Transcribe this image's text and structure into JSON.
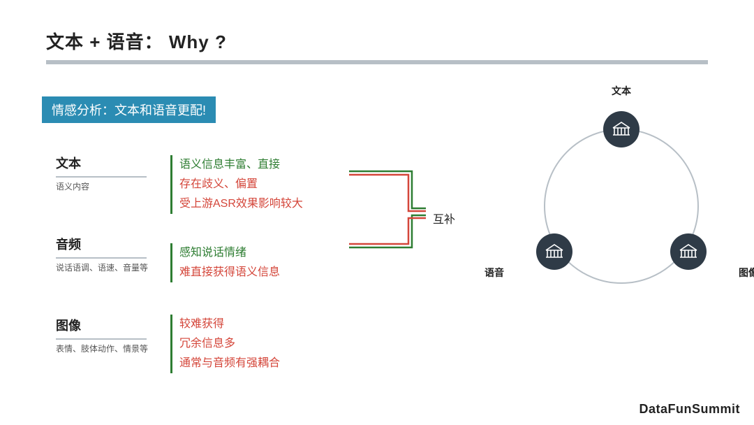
{
  "title": "文本 + 语音： Why ?",
  "badge": "情感分析：文本和语音更配!",
  "blocks": {
    "text": {
      "heading": "文本",
      "sub": "语义内容"
    },
    "audio": {
      "heading": "音频",
      "sub": "说话语调、语速、音量等"
    },
    "image": {
      "heading": "图像",
      "sub": "表情、肢体动作、情景等"
    }
  },
  "features": {
    "text": {
      "green": "语义信息丰富、直接",
      "red1": "存在歧义、偏置",
      "red2": "受上游ASR效果影响较大"
    },
    "audio": {
      "green": "感知说话情绪",
      "red1": "难直接获得语义信息"
    },
    "image": {
      "red1": "较难获得",
      "red2": "冗余信息多",
      "red3": "通常与音频有强耦合"
    }
  },
  "complement_label": "互补",
  "graph": {
    "top": "文本",
    "left": "语音",
    "right": "图像",
    "icon": "bank-icon"
  },
  "footer": "DataFunSummit"
}
